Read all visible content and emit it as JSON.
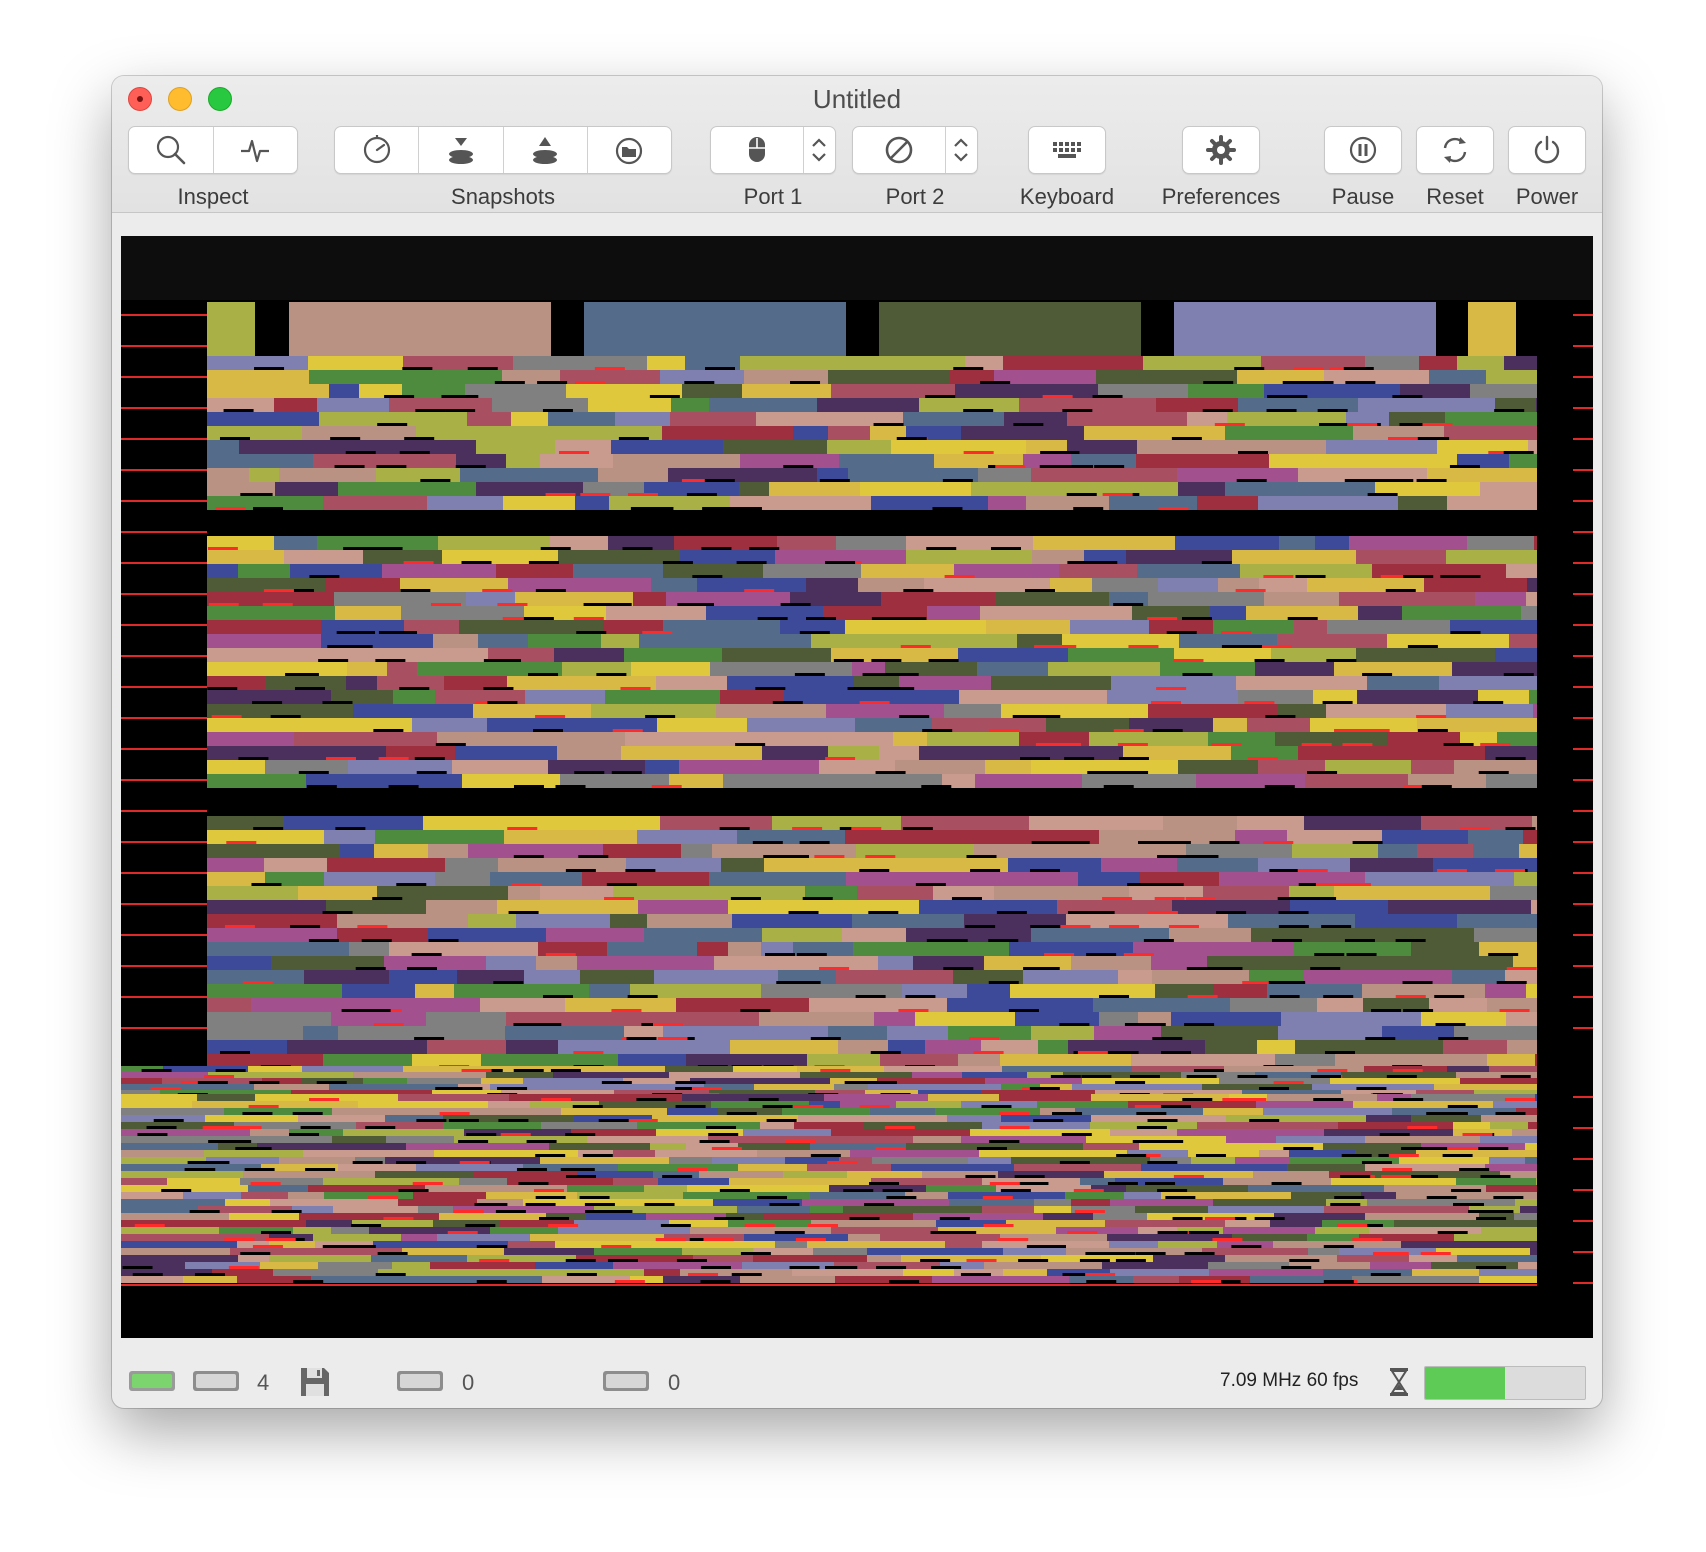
{
  "window": {
    "title": "Untitled"
  },
  "toolbar": {
    "inspect_label": "Inspect",
    "snapshots_label": "Snapshots",
    "port1_label": "Port 1",
    "port2_label": "Port 2",
    "keyboard_label": "Keyboard",
    "preferences_label": "Preferences",
    "pause_label": "Pause",
    "reset_label": "Reset",
    "power_label": "Power"
  },
  "icons": {
    "inspect": "magnifier-icon",
    "monitor": "waveform-icon",
    "timer": "clock-icon",
    "take_snapshot": "stack-down-icon",
    "restore_snapshot": "stack-up-icon",
    "browse_snapshots": "folder-clock-icon",
    "port1": "mouse-icon",
    "port2": "no-device-icon",
    "keyboard": "keyboard-icon",
    "preferences": "gear-icon",
    "pause": "pause-icon",
    "reset": "reset-icon",
    "power": "power-icon"
  },
  "statusbar": {
    "drive8_count": "4",
    "drive10_count": "0",
    "drive11_count": "0",
    "speed": "7.09 MHz 60 fps",
    "load_fraction": 0.5
  },
  "colors": {
    "screen_bg": "#000000",
    "led_green": "#7cd46e",
    "meter_fill": "#5ecb57"
  }
}
